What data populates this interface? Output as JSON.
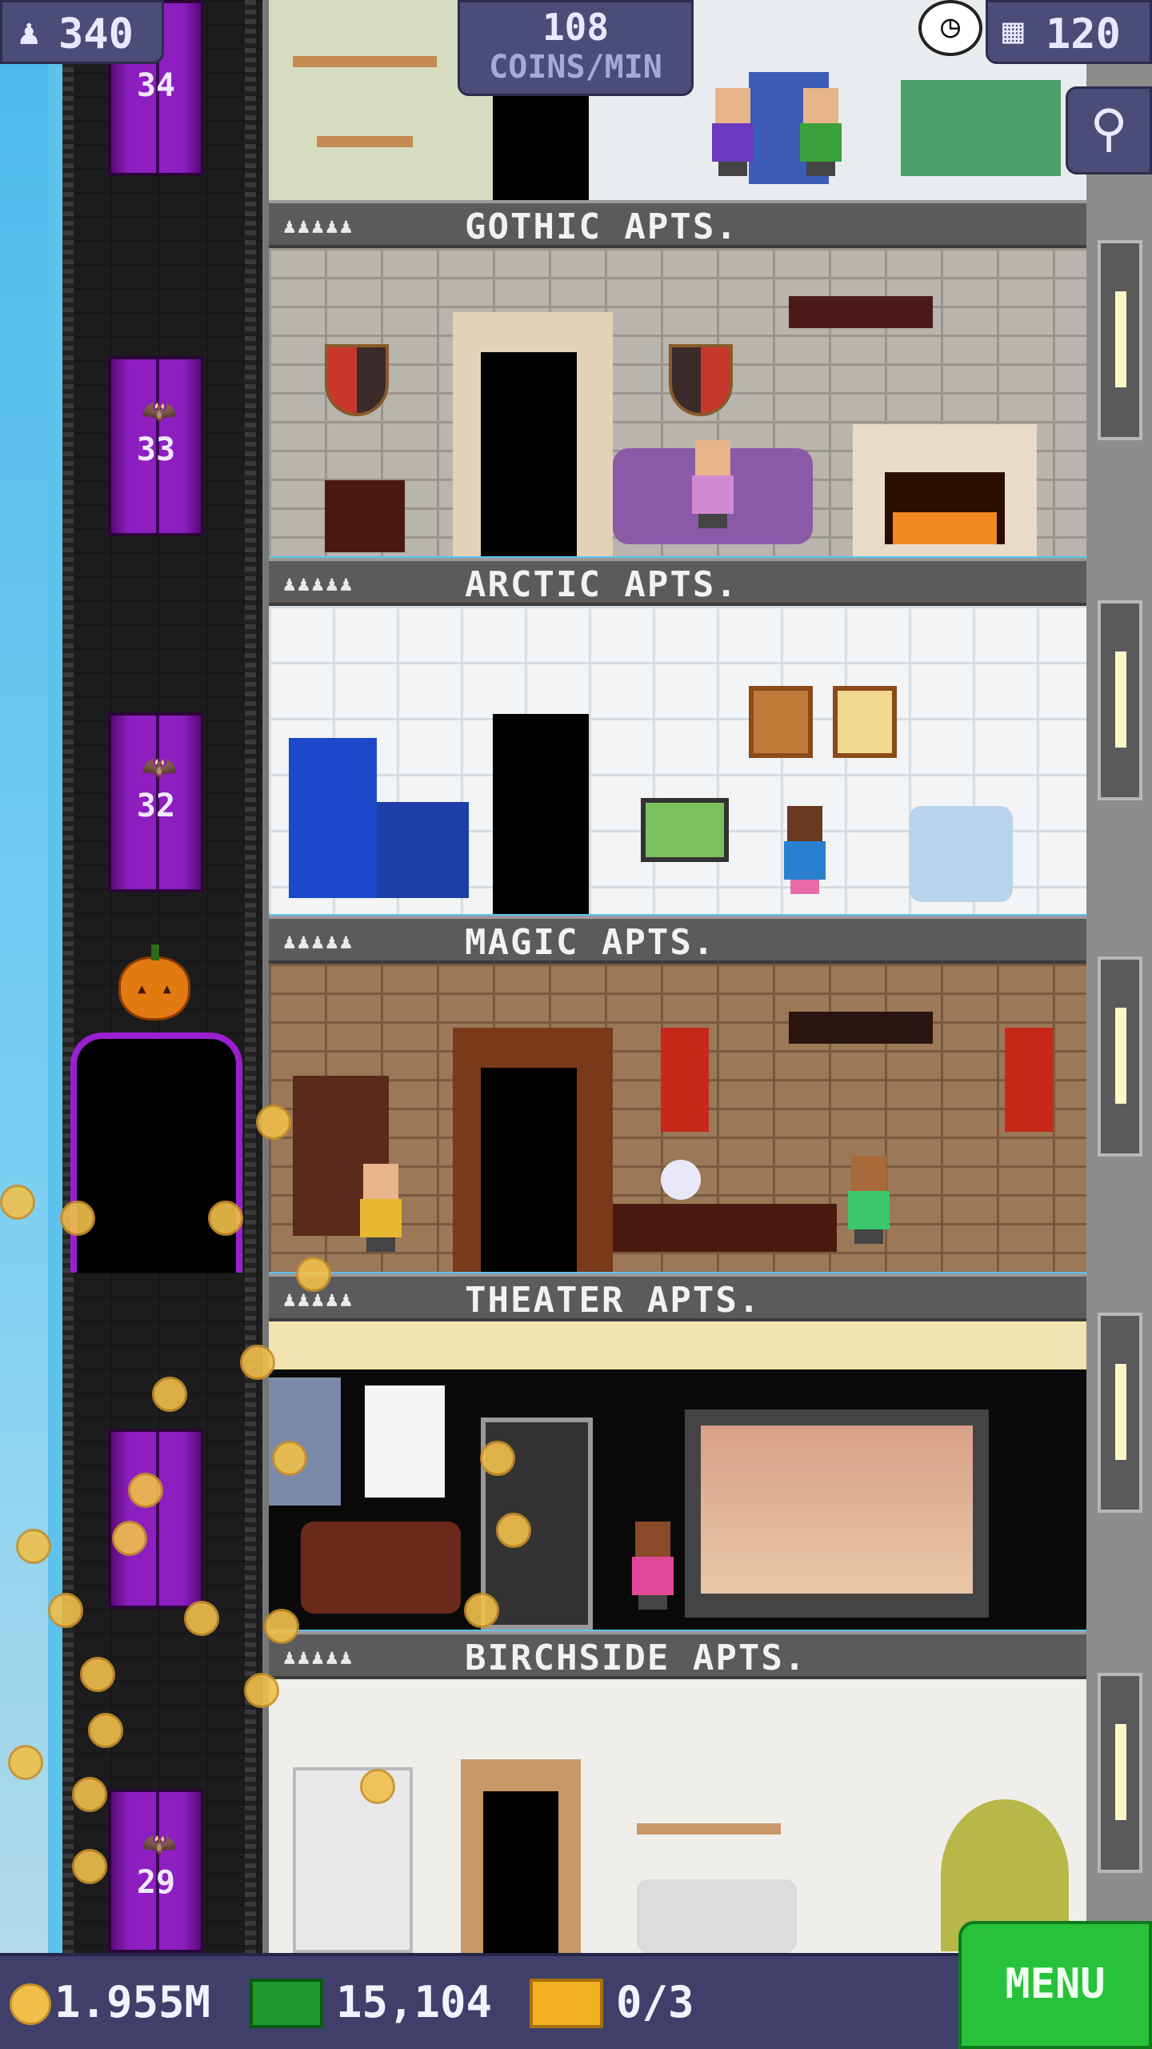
{
  "hud": {
    "population": "340",
    "coins_per_min_value": "108",
    "coins_per_min_label": "COINS/MIN",
    "floors": "120"
  },
  "elevator": {
    "floor_numbers": [
      "34",
      "33",
      "32",
      "29"
    ]
  },
  "floors": [
    {
      "name": "GOTHIC APTS.",
      "occupancy": "♟♟♟♟♟"
    },
    {
      "name": "ARCTIC APTS.",
      "occupancy": "♟♟♟♟♟"
    },
    {
      "name": "MAGIC APTS.",
      "occupancy": "♟♟♟♟♟"
    },
    {
      "name": "THEATER APTS.",
      "occupancy": "♟♟♟♟♟"
    },
    {
      "name": "BIRCHSIDE APTS.",
      "occupancy": "♟♟♟♟♟"
    }
  ],
  "bottom": {
    "coins": "1.955M",
    "bux": "15,104",
    "tickets": "0/3",
    "menu_label": "MENU"
  },
  "colors": {
    "elevator_purple": "#8d1ec0",
    "menu_green": "#27c23a",
    "hud_bg": "#4c4c78"
  },
  "icons": [
    "person-icon",
    "clock-icon",
    "building-icon",
    "magnify-icon",
    "coin-icon",
    "bux-icon",
    "ticket-icon",
    "pumpkin-icon",
    "bat-icon"
  ]
}
